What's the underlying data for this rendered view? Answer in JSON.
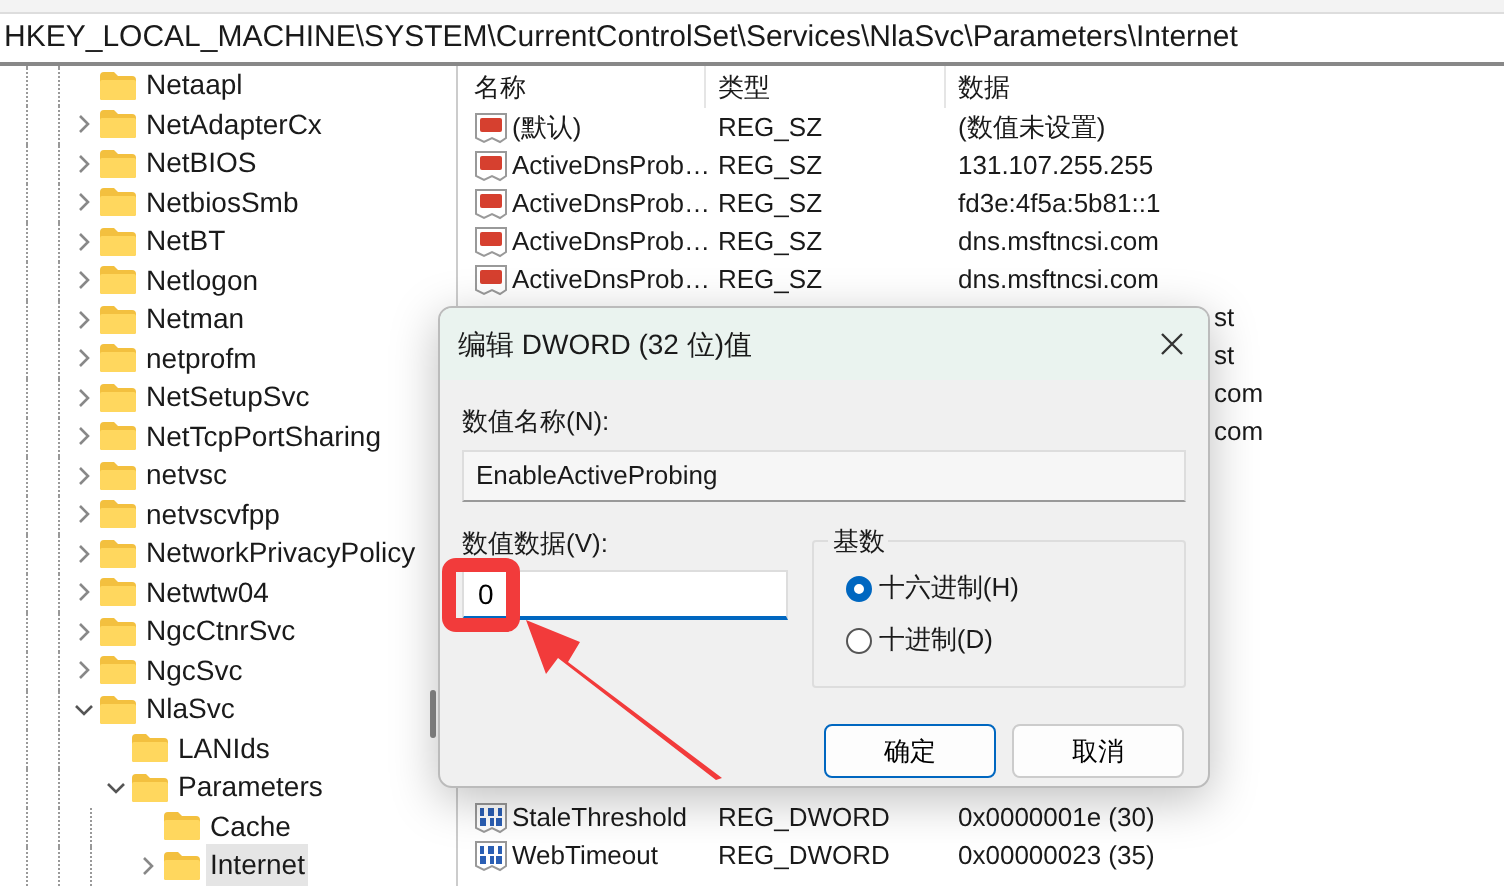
{
  "address_bar": {
    "path": "HKEY_LOCAL_MACHINE\\SYSTEM\\CurrentControlSet\\Services\\NlaSvc\\Parameters\\Internet"
  },
  "tree": [
    {
      "label": "Netaapl"
    },
    {
      "label": "NetAdapterCx",
      "expanded": false
    },
    {
      "label": "NetBIOS",
      "expanded": false
    },
    {
      "label": "NetbiosSmb",
      "expanded": false
    },
    {
      "label": "NetBT",
      "expanded": false
    },
    {
      "label": "Netlogon",
      "expanded": false
    },
    {
      "label": "Netman",
      "expanded": false
    },
    {
      "label": "netprofm",
      "expanded": false
    },
    {
      "label": "NetSetupSvc",
      "expanded": false
    },
    {
      "label": "NetTcpPortSharing",
      "expanded": false
    },
    {
      "label": "netvsc",
      "expanded": false
    },
    {
      "label": "netvscvfpp",
      "expanded": false
    },
    {
      "label": "NetworkPrivacyPolicy",
      "expanded": false
    },
    {
      "label": "Netwtw04",
      "expanded": false
    },
    {
      "label": "NgcCtnrSvc",
      "expanded": false
    },
    {
      "label": "NgcSvc",
      "expanded": false
    },
    {
      "label": "NlaSvc",
      "expanded": true,
      "children": [
        {
          "label": "LANIds"
        },
        {
          "label": "Parameters",
          "expanded": true,
          "children": [
            {
              "label": "Cache"
            },
            {
              "label": "Internet",
              "expanded": false,
              "selected": true
            }
          ]
        }
      ]
    }
  ],
  "values": {
    "columns": [
      "名称",
      "类型",
      "数据"
    ],
    "rows": [
      {
        "kind": "string",
        "name": "(默认)",
        "type": "REG_SZ",
        "data": "(数值未设置)"
      },
      {
        "kind": "string",
        "name": "ActiveDnsProb…",
        "type": "REG_SZ",
        "data": "131.107.255.255"
      },
      {
        "kind": "string",
        "name": "ActiveDnsProb…",
        "type": "REG_SZ",
        "data": "fd3e:4f5a:5b81::1"
      },
      {
        "kind": "string",
        "name": "ActiveDnsProb…",
        "type": "REG_SZ",
        "data": "dns.msftncsi.com"
      },
      {
        "kind": "string",
        "name": "ActiveDnsProb…",
        "type": "REG_SZ",
        "data": "dns.msftncsi.com"
      },
      {
        "kind": "partial",
        "data": "st"
      },
      {
        "kind": "partial",
        "data": "st"
      },
      {
        "kind": "partial",
        "data": "com"
      },
      {
        "kind": "partial",
        "data": "com"
      },
      {
        "kind": "dword",
        "name": "StaleThreshold",
        "type": "REG_DWORD",
        "data": "0x0000001e (30)"
      },
      {
        "kind": "dword",
        "name": "WebTimeout",
        "type": "REG_DWORD",
        "data": "0x00000023 (35)"
      }
    ]
  },
  "dialog": {
    "title": "编辑 DWORD (32 位)值",
    "name_label": "数值名称(N):",
    "name_value": "EnableActiveProbing",
    "data_label": "数值数据(V):",
    "data_value": "0",
    "base_label": "基数",
    "bases": [
      {
        "label": "十六进制(H)",
        "selected": true
      },
      {
        "label": "十进制(D)",
        "selected": false
      }
    ],
    "buttons": [
      {
        "label": "确定",
        "default": true
      },
      {
        "label": "取消",
        "default": false
      }
    ]
  }
}
